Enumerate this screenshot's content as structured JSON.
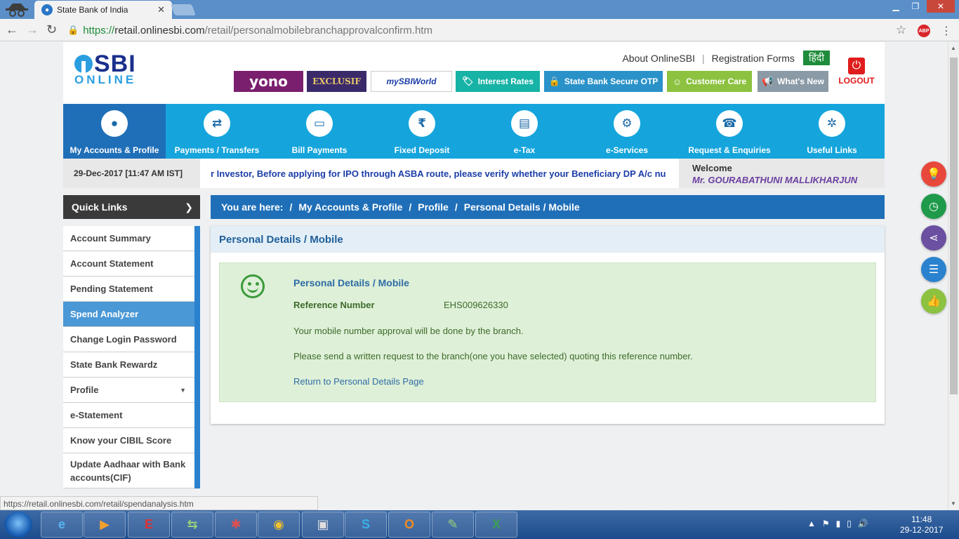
{
  "browser": {
    "tab_title": "State Bank of India",
    "url_scheme": "https://",
    "url_host": "retail.onlinesbi.com",
    "url_path": "/retail/personalmobilebranchapprovalconfirm.htm",
    "status_url": "https://retail.onlinesbi.com/retail/spendanalysis.htm",
    "abp_label": "ABP"
  },
  "header": {
    "logo_sbi": "SBI",
    "logo_online": "ONLINE",
    "links": [
      "About OnlineSBI",
      "Registration Forms"
    ],
    "hindi": "हिंदी",
    "logout": "LOGOUT",
    "promos": {
      "yono": "yono",
      "exclusif": "EXCLUSIF",
      "sbiworld": "mySBIWorld",
      "interest_rates": "Interest Rates",
      "secure_otp": "State Bank Secure OTP",
      "customer_care": "Customer Care",
      "whats_new": "What's New"
    },
    "promo_colors": {
      "interest_rates": "#16b3a6",
      "secure_otp": "#2a92c9",
      "customer_care": "#8cc23f",
      "whats_new": "#8a9aa6"
    }
  },
  "nav": {
    "items": [
      {
        "label": "My Accounts & Profile",
        "icon": "user-icon"
      },
      {
        "label": "Payments / Transfers",
        "icon": "transfer-icon"
      },
      {
        "label": "Bill Payments",
        "icon": "bill-icon"
      },
      {
        "label": "Fixed Deposit",
        "icon": "deposit-icon"
      },
      {
        "label": "e-Tax",
        "icon": "tax-icon"
      },
      {
        "label": "e-Services",
        "icon": "services-icon"
      },
      {
        "label": "Request & Enquiries",
        "icon": "phone-icon"
      },
      {
        "label": "Useful Links",
        "icon": "links-icon"
      }
    ]
  },
  "info": {
    "datetime": "29-Dec-2017 [11:47 AM IST]",
    "ticker": "r Investor, Before applying for IPO through ASBA route, please verify whether your Beneficiary DP A/c nu",
    "welcome": "Welcome",
    "user_name": "Mr. GOURABATHUNI MALLIKHARJUN"
  },
  "quick_links": {
    "title": "Quick Links",
    "items": [
      "Account Summary",
      "Account Statement",
      "Pending Statement",
      "Spend Analyzer",
      "Change Login Password",
      "State Bank Rewardz",
      "Profile",
      "e-Statement",
      "Know your CIBIL Score",
      "Update Aadhaar with Bank accounts(CIF)"
    ],
    "active_index": 3
  },
  "breadcrumb": {
    "prefix": "You are here:",
    "items": [
      "My Accounts & Profile",
      "Profile",
      "Personal Details / Mobile"
    ]
  },
  "content": {
    "heading": "Personal Details / Mobile",
    "success_title": "Personal Details / Mobile",
    "ref_label": "Reference Number",
    "ref_value": "EHS009626330",
    "message1": "Your mobile number approval will be done by the branch.",
    "message2": "Please send a written request to the branch(one you have selected) quoting this reference number.",
    "return_link": "Return to Personal Details Page"
  },
  "floating": [
    {
      "icon": "bulb-icon",
      "color": "#e8473b"
    },
    {
      "icon": "history-icon",
      "color": "#1e9a4a"
    },
    {
      "icon": "share-icon",
      "color": "#6b4fa0"
    },
    {
      "icon": "profile-list-icon",
      "color": "#2a82cf"
    },
    {
      "icon": "thumbs-up-icon",
      "color": "#8cc23f"
    }
  ],
  "taskbar": {
    "time": "11:48",
    "date": "29-12-2017"
  }
}
